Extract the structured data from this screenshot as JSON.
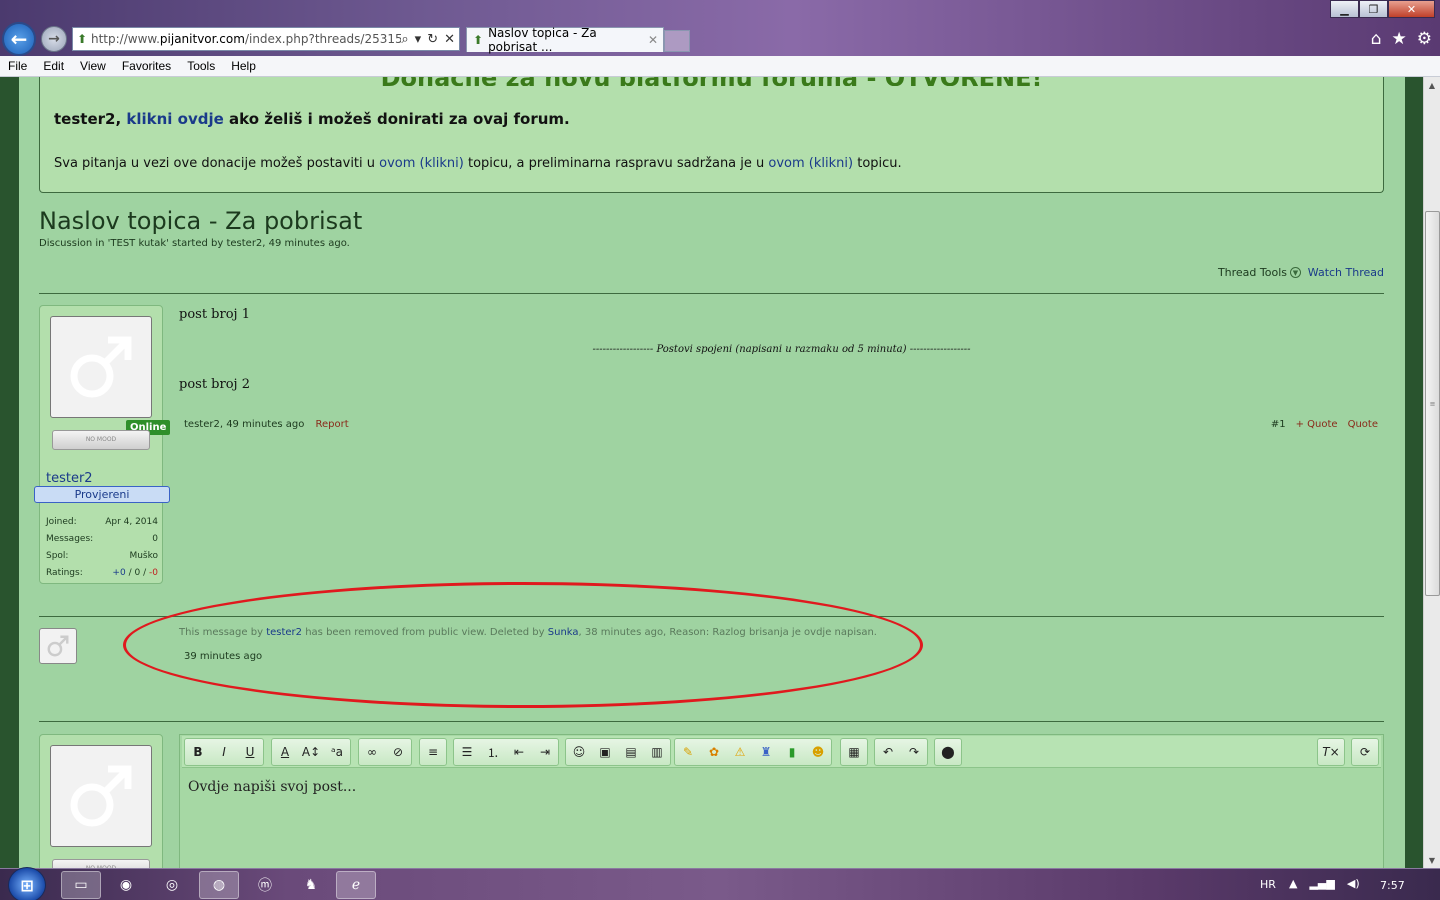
{
  "browser": {
    "address": "http://www.pijanitvor.com/index.php?threads/25315/",
    "address_prefix": "http://www.",
    "address_domain": "pijanitvor.com",
    "address_path": "/index.php?threads/25315/",
    "tab_title": "Naslov topica - Za pobrisat ...",
    "menu": [
      "File",
      "Edit",
      "View",
      "Favorites",
      "Tools",
      "Help"
    ]
  },
  "notice": {
    "title": "Donacije za novu platformu foruma - OTVORENE!",
    "line1_user": "tester2,",
    "line1_link": "klikni ovdje",
    "line1_rest": "ako želiš i možeš donirati za ovaj forum.",
    "line2_a": "Sva pitanja u vezi ove donacije možeš postaviti u",
    "line2_link1": "ovom (klikni)",
    "line2_b": "topicu, a preliminarna raspravu sadržana je u",
    "line2_link2": "ovom (klikni)",
    "line2_c": "topicu."
  },
  "thread": {
    "title": "Naslov topica - Za pobrisat",
    "meta": "Discussion in 'TEST kutak' started by tester2, 49 minutes ago.",
    "tools_label": "Thread Tools",
    "watch_label": "Watch Thread"
  },
  "post1": {
    "user": {
      "name": "tester2",
      "title": "Provjereni",
      "online": "Online",
      "mood": "NO MOOD",
      "joined_label": "Joined:",
      "joined": "Apr 4, 2014",
      "messages_label": "Messages:",
      "messages": "0",
      "spol_label": "Spol:",
      "spol": "Muško",
      "ratings_label": "Ratings:",
      "ratings_pos": "+0",
      "ratings_sep1": "/",
      "ratings_mid": "0",
      "ratings_sep2": "/",
      "ratings_neg": "-0"
    },
    "text1": "post broj 1",
    "merged_note": "------------------ Postovi spojeni (napisani u razmaku od 5 minuta) ------------------",
    "text2": "post broj 2",
    "meta_time": "tester2, 49 minutes ago",
    "report": "Report",
    "number": "#1",
    "multiquote": "+ Quote",
    "quote": "Quote"
  },
  "deleted_post": {
    "msg_a": "This message by",
    "msg_user": "tester2",
    "msg_b": "has been removed from public view. Deleted by",
    "msg_deleter": "Sunka",
    "msg_c": ", 38 minutes ago, Reason: Razlog brisanja je ovdje napisan.",
    "time": "39 minutes ago"
  },
  "reply": {
    "mood": "NO MOOD",
    "placeholder": "Ovdje napiši svoj post..."
  },
  "taskbar": {
    "lang": "HR",
    "clock": "7:57"
  },
  "colors": {
    "page_bg": "#9fd3a1",
    "notice_bg": "#b3dfac",
    "link": "#1a3a8a",
    "annotation": "#e0191e"
  }
}
